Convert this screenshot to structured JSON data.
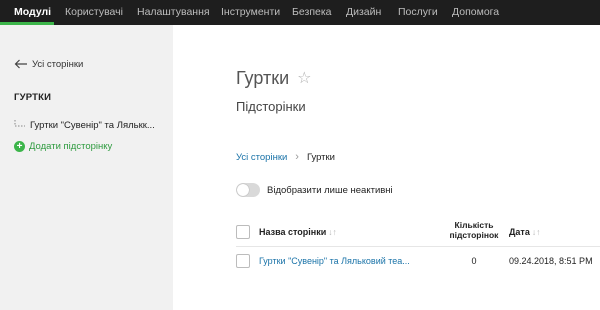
{
  "topnav": {
    "items": [
      "Модулі",
      "Користувачі",
      "Налаштування",
      "Інструменти",
      "Безпека",
      "Дизайн",
      "Послуги",
      "Допомога"
    ],
    "active_index": 0,
    "accent_color": "#3cb54a"
  },
  "sidebar": {
    "back_label": "Усі сторінки",
    "section_title": "ГУРТКИ",
    "page_item": "Гуртки \"Сувенір\" та Лялькк...",
    "add_label": "Додати підсторінку"
  },
  "main": {
    "title": "Гуртки",
    "subtitle": "Підсторінки",
    "breadcrumb": {
      "root": "Усі сторінки",
      "current": "Гуртки"
    },
    "toggle": {
      "label": "Відобразити лише неактивні",
      "on": false
    },
    "table": {
      "headers": {
        "name": "Назва сторінки",
        "count_line1": "Кількість",
        "count_line2": "підсторінок",
        "date": "Дата"
      },
      "rows": [
        {
          "name": "Гуртки \"Сувенір\" та Ляльковий теа...",
          "count": "0",
          "date": "09.24.2018, 8:51 PM"
        }
      ]
    }
  }
}
